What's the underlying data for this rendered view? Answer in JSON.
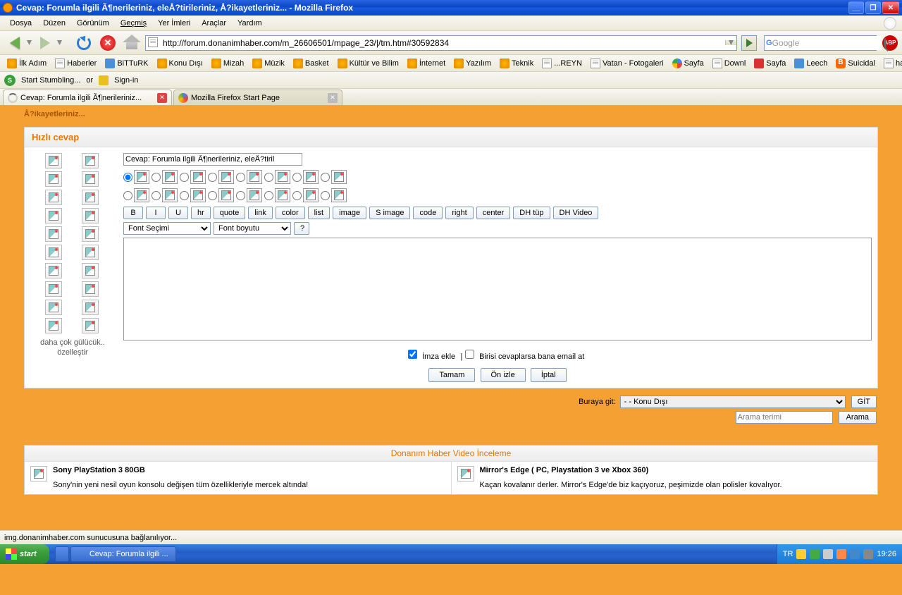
{
  "window": {
    "title": "Cevap: Forumla ilgili Ã¶nerileriniz, eleÅ?tirileriniz, Å?ikayetleriniz... - Mozilla Firefox"
  },
  "menu": {
    "file": "Dosya",
    "edit": "Düzen",
    "view": "Görünüm",
    "history": "Geçmiş",
    "bookmarks": "Yer İmleri",
    "tools": "Araçlar",
    "help": "Yardım"
  },
  "nav": {
    "url": "http://forum.donanimhaber.com/m_26606501/mpage_23/|/tm.htm#30592834",
    "search_placeholder": "Google"
  },
  "bookmarks": [
    {
      "label": "İlk Adım",
      "icon": "orange"
    },
    {
      "label": "Haberler",
      "icon": "page"
    },
    {
      "label": "BiTTuRK",
      "icon": "blue"
    },
    {
      "label": "Konu Dışı",
      "icon": "orange"
    },
    {
      "label": "Mizah",
      "icon": "orange"
    },
    {
      "label": "Müzik",
      "icon": "orange"
    },
    {
      "label": "Basket",
      "icon": "orange"
    },
    {
      "label": "Kültür ve Bilim",
      "icon": "orange"
    },
    {
      "label": "İnternet",
      "icon": "orange"
    },
    {
      "label": "Yazılım",
      "icon": "orange"
    },
    {
      "label": "Teknik",
      "icon": "orange"
    },
    {
      "label": "...REYN",
      "icon": "page"
    },
    {
      "label": "Vatan - Fotogaleri",
      "icon": "page"
    },
    {
      "label": "Sayfa",
      "icon": "g"
    },
    {
      "label": "Downl",
      "icon": "page"
    },
    {
      "label": "Sayfa",
      "icon": "red"
    },
    {
      "label": "Leech",
      "icon": "blue"
    },
    {
      "label": "Suicidal",
      "icon": "blogger"
    },
    {
      "label": "hay...",
      "icon": "page"
    }
  ],
  "stumble": {
    "start": "Start Stumbling...",
    "or": "or",
    "signin": "Sign-in"
  },
  "tabs": [
    {
      "label": "Cevap: Forumla ilgili Ã¶nerileriniz...",
      "active": true,
      "loading": true
    },
    {
      "label": "Mozilla Firefox Start Page",
      "active": false,
      "loading": false
    }
  ],
  "breadcrumb": "Å?ikayetleriniz...",
  "reply": {
    "title": "Hızlı cevap",
    "subject": "Cevap: Forumla ilgili Ã¶nerileriniz, eleÅ?tiril",
    "fmt": {
      "b": "B",
      "i": "I",
      "u": "U",
      "hr": "hr",
      "quote": "quote",
      "link": "link",
      "color": "color",
      "list": "list",
      "image": "image",
      "simage": "S image",
      "code": "code",
      "right": "right",
      "center": "center",
      "dhtup": "DH tüp",
      "dhvideo": "DH Video"
    },
    "font_sel": "Font Seçimi",
    "size_sel": "Font boyutu",
    "help": "?",
    "sig": "İmza ekle",
    "sep": "|",
    "email": "Birisi cevaplarsa bana email at",
    "ok": "Tamam",
    "preview": "Ön izle",
    "cancel": "İptal",
    "more_emoji": "daha çok gülücük..",
    "customize": "özelleştir"
  },
  "goto": {
    "label": "Buraya git:",
    "value": "- - Konu Dışı",
    "btn": "GİT"
  },
  "search": {
    "placeholder": "Arama terimi",
    "btn": "Arama"
  },
  "video": {
    "head": "Donanım Haber Video İnceleme",
    "col1": {
      "title": "Sony PlayStation 3 80GB",
      "desc": "Sony'nin yeni nesil oyun konsolu değişen tüm özellikleriyle mercek altında!"
    },
    "col2": {
      "title": "Mirror's Edge ( PC, Playstation 3 ve Xbox 360)",
      "desc": "Kaçan kovalanır derler. Mirror's Edge'de biz kaçıyoruz, peşimizde olan polisler kovalıyor."
    }
  },
  "status": "img.donanimhaber.com sunucusuna bağlanılıyor...",
  "taskbar": {
    "start": "start",
    "task": "Cevap: Forumla ilgili ...",
    "lang": "TR",
    "time": "19:26"
  }
}
